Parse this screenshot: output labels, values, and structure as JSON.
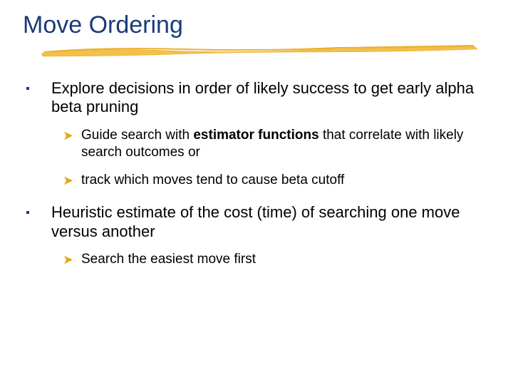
{
  "title": "Move Ordering",
  "bullets": [
    {
      "text": "Explore decisions in order of likely success to get early alpha beta pruning",
      "sub": [
        {
          "pre": "Guide search with ",
          "bold": "estimator functions",
          "post": " that correlate with likely search outcomes or"
        },
        {
          "pre": "track which moves tend to cause beta cutoff",
          "bold": "",
          "post": ""
        }
      ]
    },
    {
      "text": "Heuristic estimate of the cost (time) of searching one move versus another",
      "sub": [
        {
          "pre": "Search the easiest move first",
          "bold": "",
          "post": ""
        }
      ]
    }
  ]
}
